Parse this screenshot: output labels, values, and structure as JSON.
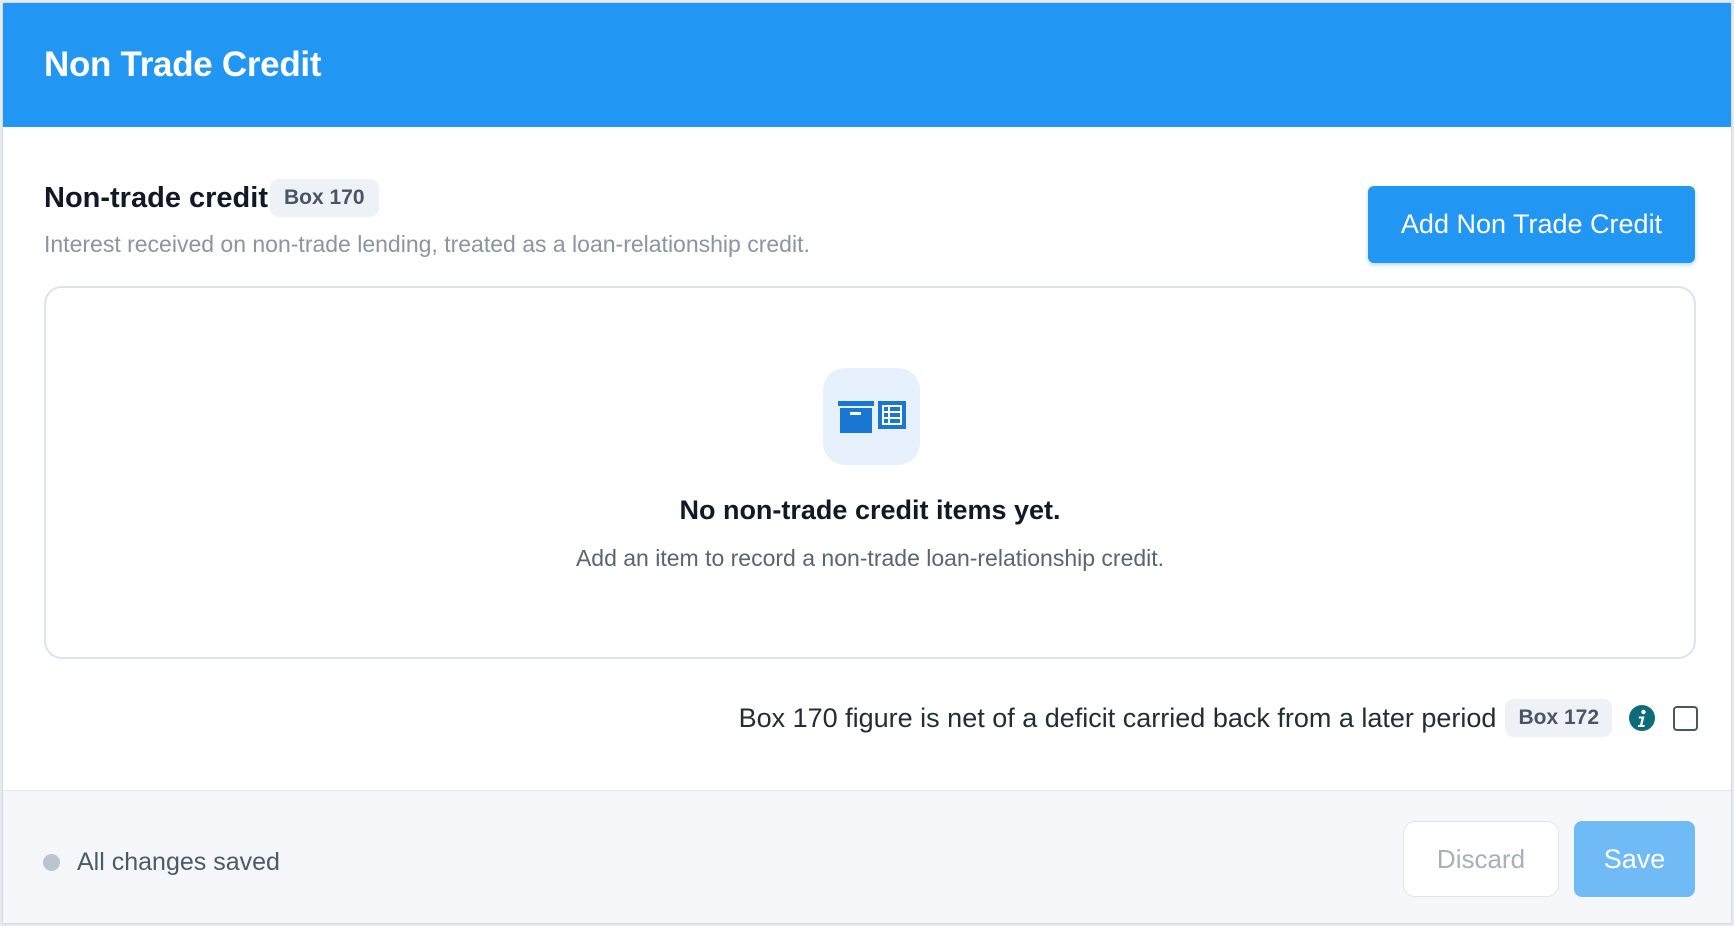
{
  "header": {
    "title": "Non Trade Credit"
  },
  "section": {
    "title": "Non-trade credit",
    "badge": "Box 170",
    "description": "Interest received on non-trade lending, treated as a loan-relationship credit.",
    "add_button": "Add Non Trade Credit"
  },
  "empty_state": {
    "icon": "archive-box-with-list-icon",
    "title": "No non-trade credit items yet.",
    "description": "Add an item to record a non-trade loan-relationship credit."
  },
  "option": {
    "label": "Box 170 figure is net of a deficit carried back from a later period",
    "badge": "Box 172",
    "info_icon": "info-icon",
    "checked": false
  },
  "footer": {
    "status": "All changes saved",
    "discard_label": "Discard",
    "save_label": "Save"
  },
  "colors": {
    "primary": "#2196f3",
    "save_disabled": "#70baf6",
    "info": "#0e6b79"
  }
}
